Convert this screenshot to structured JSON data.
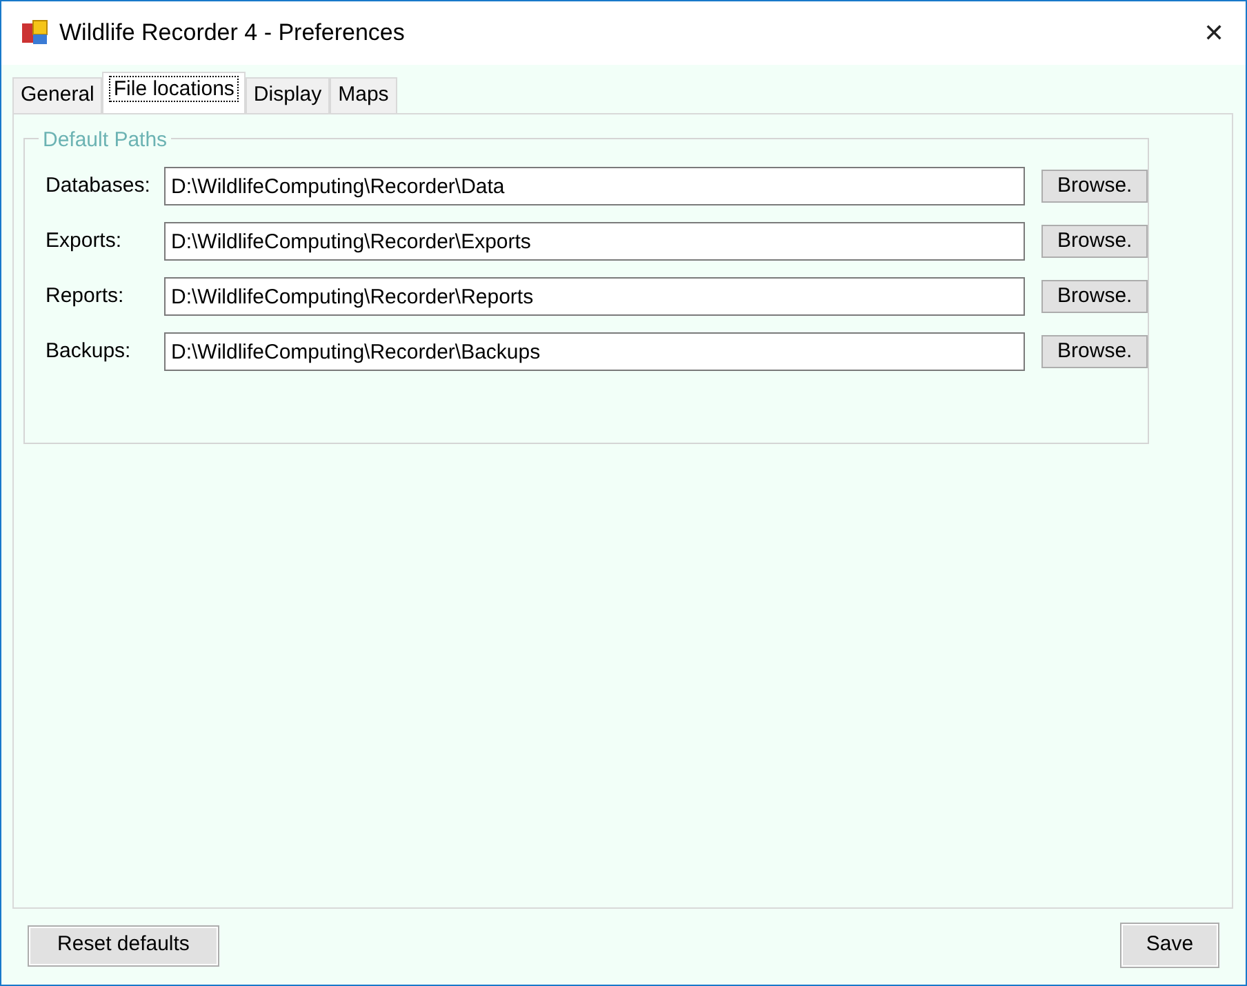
{
  "window": {
    "title": "Wildlife Recorder 4 - Preferences",
    "close": "✕"
  },
  "tabs": [
    {
      "label": "General",
      "selected": false
    },
    {
      "label": "File locations",
      "selected": true
    },
    {
      "label": "Display",
      "selected": false
    },
    {
      "label": "Maps",
      "selected": false
    }
  ],
  "group": {
    "title": "Default Paths",
    "rows": [
      {
        "label": "Databases:",
        "value": "D:\\WildlifeComputing\\Recorder\\Data",
        "button": "Browse."
      },
      {
        "label": "Exports:",
        "value": "D:\\WildlifeComputing\\Recorder\\Exports",
        "button": "Browse."
      },
      {
        "label": "Reports:",
        "value": "D:\\WildlifeComputing\\Recorder\\Reports",
        "button": "Browse."
      },
      {
        "label": "Backups:",
        "value": "D:\\WildlifeComputing\\Recorder\\Backups",
        "button": "Browse."
      }
    ]
  },
  "buttons": {
    "reset": "Reset defaults",
    "save": "Save"
  }
}
